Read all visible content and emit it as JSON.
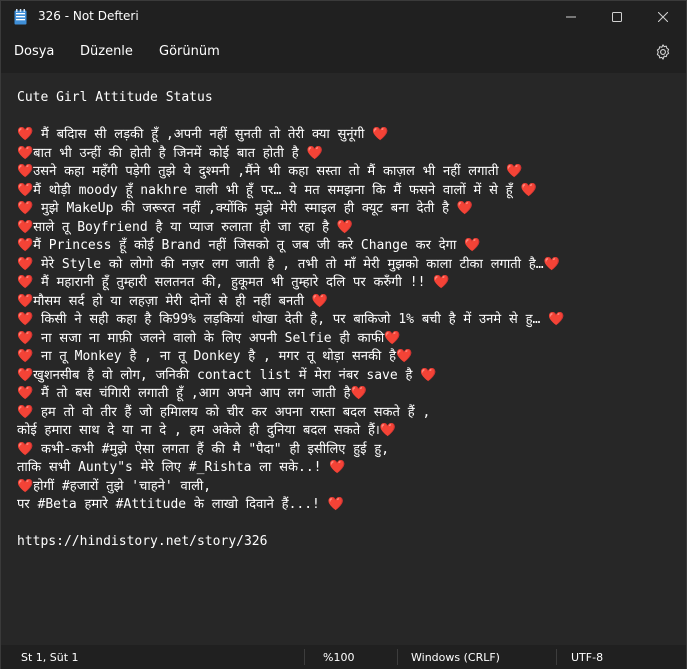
{
  "window": {
    "title": "326 - Not Defteri",
    "minimize_glyph": "—",
    "maximize_glyph": "☐",
    "close_glyph": "✕"
  },
  "menu": {
    "items": [
      "Dosya",
      "Düzenle",
      "Görünüm"
    ],
    "settings_icon": "gear-icon"
  },
  "editor": {
    "lines": [
      "Cute Girl Attitude Status",
      "",
      "❤️  मैं बदिास सी लड़की हूँ ,अपनी नहीं सुनती तो तेरी क्या सुनूंगी ❤️",
      "❤️बात भी उन्हीं की होती है जिनमें कोई बात होती है  ❤️",
      "❤️उसने कहा महँगी पड़ेगी तुझे ये दुश्मनी ,मैंने भी कहा सस्ता तो मैं काज़ल भी नहीं लगाती ❤️",
      "❤️मैं थोड़ी moody हूँ nakhre  वाली भी हूँ पर…  ये मत समझना कि मैं फसने वालों में से हूँ ❤️",
      "❤️  मुझे MakeUp की जरूरत नहीं ,क्योंकि मुझे मेरी स्माइल ही क्यूट बना देती है ❤️",
      "❤️साले तू Boyfriend है या  प्याज रुलाता ही जा रहा है  ❤️",
      "❤️मैं Princess हूँ कोई Brand नहीं जिसको तू जब जी करे Change कर देगा ❤️",
      "❤️  मेरे Style को लोगो की नज़र लग जाती है ,  तभी तो माँ मेरी मुझको काला टीका लगाती है…❤️",
      "❤️  मैं महारानी हूँ तुम्हारी सलतनत की,  हुकूमत भी तुम्हारे दलि पर करुँगी !!  ❤️",
      "❤️मौसम सर्द हो या लहज़ा मेरी दोनों से ही नहीं बनती  ❤️",
      "❤️  किसी ने सही कहा है कि99% लड़कियां धोखा देती है,  पर बाकिजो 1% बची है में उनमे से हु…  ❤️",
      "❤️  ना सजा ना माफ़ी जलने वालो के लिए अपनी Selfie ही काफी❤️",
      "❤️  ना तू Monkey है ,  ना तू Donkey है ,   मगर तू थोड़ा सनकी है❤️",
      "❤️खुशनसीब है वो लोग,  जनिकी contact list में मेरा नंबर save है  ❤️",
      "❤️    मैं तो बस चंगिारी लगाती हूँ ,आग अपने आप लग जाती है❤️",
      "❤️  हम तो वो तीर हैं जो हमिालय को चीर कर अपना रास्ता बदल सकते हैं ,",
      "कोई हमारा साथ दे या ना दे ,  हम अकेले ही दुनिया बदल सकते हैं।❤️",
      "❤️  कभी-कभी #मुझे ऐसा लगता हैं की मै \"पैदा\"  ही इसीलिए हुई हु,",
      "ताकि सभी Aunty\"s मेरे लिए #_Rishta ला सके..!  ❤️",
      "❤️होगीं #हजारों तुझे 'चाहने'  वाली,",
      "पर #Beta हमारे #Attitude के लाखो दिवाने हैं...!  ❤️",
      "",
      "https://hindistory.net/story/326"
    ]
  },
  "status": {
    "position": "St 1, Süt 1",
    "zoom": "%100",
    "line_ending": "Windows (CRLF)",
    "encoding": "UTF-8"
  }
}
